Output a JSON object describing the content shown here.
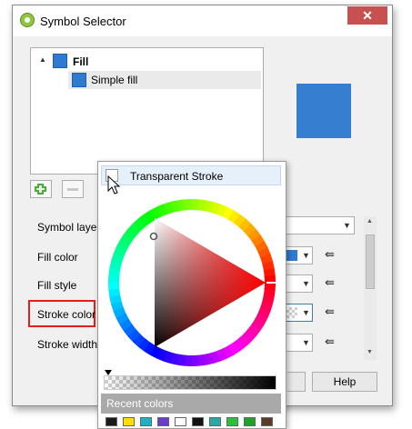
{
  "window": {
    "title": "Symbol Selector",
    "close_glyph": "✕"
  },
  "tree": {
    "root_label": "Fill",
    "child_label": "Simple fill",
    "expand_glyph": "▲"
  },
  "preview": {
    "color": "#367fd0"
  },
  "toolbar": {
    "add_icon": "add-layer-icon",
    "remove_icon": "remove-layer-icon"
  },
  "properties": {
    "symbol_layer_type_label": "Symbol layer ty",
    "fill_color_label": "Fill color",
    "fill_style_label": "Fill style",
    "stroke_color_label": "Stroke color",
    "stroke_width_label": "Stroke width",
    "fill_color_value": "#2f7bd1"
  },
  "buttons": {
    "help": "Help"
  },
  "color_popup": {
    "transparent_label": "Transparent Stroke",
    "recent_label": "Recent colors",
    "recent_colors": [
      "#1a1a1a",
      "#ffe000",
      "#21b1c5",
      "#6a3fc6",
      "#ffffff",
      "#111111",
      "#2aa7a7",
      "#27c13a",
      "#1ea22a",
      "#5a3b2a"
    ]
  }
}
